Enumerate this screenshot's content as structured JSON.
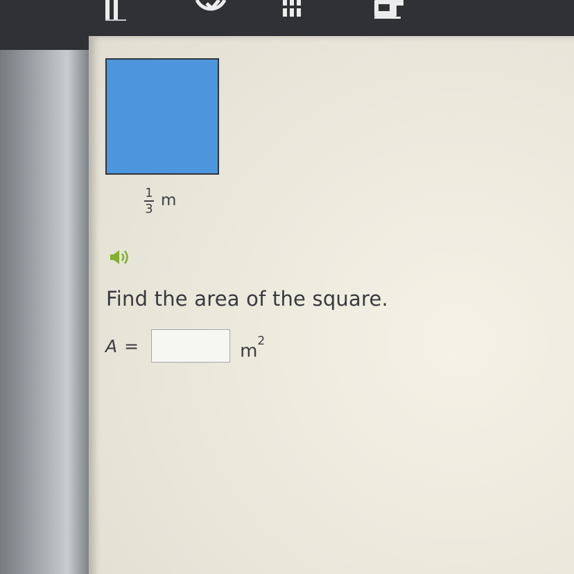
{
  "toolbar": {
    "icons": [
      "menu-icon",
      "check-circle-icon",
      "list-icon",
      "calculator-icon"
    ]
  },
  "problem": {
    "figure": {
      "shape": "square",
      "fill_color": "#4d96dc",
      "side_length": {
        "numerator": "1",
        "denominator": "3",
        "unit": "m"
      }
    },
    "audio_icon": "speaker-icon",
    "question": "Find the area of the square.",
    "answer": {
      "variable": "A",
      "equals": "=",
      "value": "",
      "unit_base": "m",
      "unit_exponent": "2"
    }
  },
  "colors": {
    "toolbar_bg": "#2f3134",
    "content_bg": "#ece9dd",
    "accent_green": "#7fb12d"
  }
}
